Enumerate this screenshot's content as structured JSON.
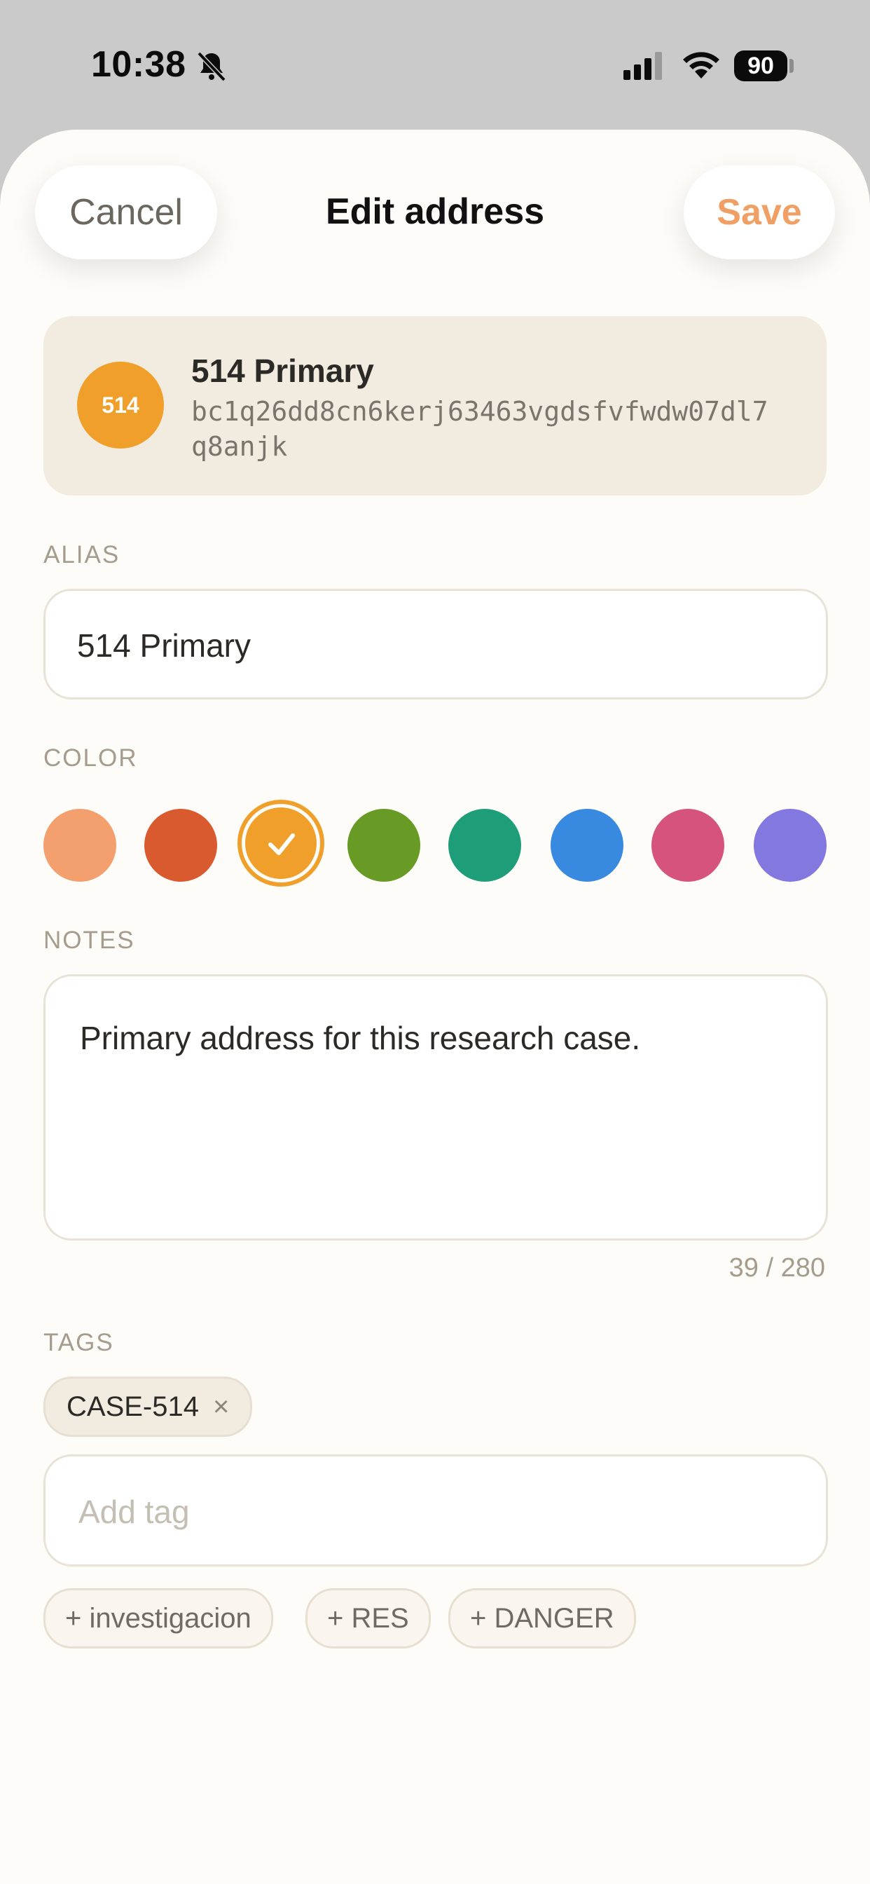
{
  "status_bar": {
    "time": "10:38",
    "battery": "90"
  },
  "header": {
    "cancel_label": "Cancel",
    "title": "Edit address",
    "save_label": "Save"
  },
  "address_card": {
    "badge": "514",
    "name": "514 Primary",
    "address": "bc1q26dd8cn6kerj63463vgdsfvfwdw07dl7q8anjk"
  },
  "alias": {
    "label": "ALIAS",
    "value": "514 Primary"
  },
  "color": {
    "label": "COLOR",
    "options": [
      "#f4a06e",
      "#d95a2e",
      "#f0a02a",
      "#679b25",
      "#1e9e78",
      "#3889e0",
      "#d6547c",
      "#8378e0"
    ],
    "selected_index": 2
  },
  "notes": {
    "label": "NOTES",
    "value": "Primary address for this research case.",
    "count": "39 / 280"
  },
  "tags": {
    "label": "TAGS",
    "current": [
      {
        "text": "CASE-514",
        "remove": "×"
      }
    ],
    "input_placeholder": "Add tag",
    "suggestions": [
      "+ investigacion",
      "+ RES",
      "+ DANGER"
    ]
  }
}
